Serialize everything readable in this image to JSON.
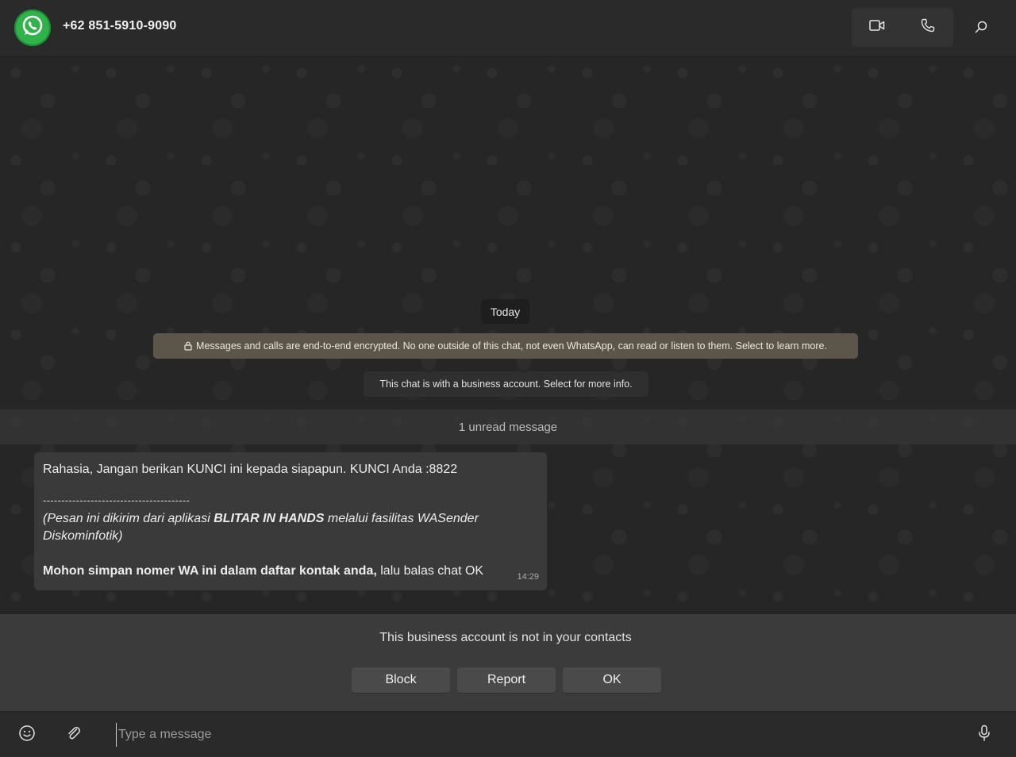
{
  "header": {
    "contact_name": "+62 851-5910-9090",
    "avatar_icon": "whatsapp-logo-icon",
    "video_call_icon": "video-camera-icon",
    "voice_call_icon": "phone-icon",
    "search_icon": "search-icon"
  },
  "chat": {
    "date_pill": "Today",
    "encryption_notice": "Messages and calls are end-to-end encrypted. No one outside of this chat, not even WhatsApp, can read or listen to them. Select to learn more.",
    "business_notice": "This chat is with a business account. Select for more info.",
    "unread_label": "1 unread message",
    "message": {
      "line1": "Rahasia, Jangan berikan KUNCI ini kepada siapapun. KUNCI Anda :8822",
      "separator": "----------------------------------------",
      "italic_prefix": "(Pesan ini dikirim dari aplikasi ",
      "italic_app": "BLITAR IN HANDS",
      "italic_suffix": " melalui fasilitas WASender Diskominfotik)",
      "closing_bold": "Mohon simpan nomer WA ini dalam daftar kontak anda,",
      "closing_rest": " lalu balas chat OK",
      "time": "14:29"
    }
  },
  "notice": {
    "text": "This business account is not in your contacts",
    "buttons": {
      "block": "Block",
      "report": "Report",
      "ok": "OK"
    }
  },
  "composer": {
    "placeholder": "Type a message",
    "emoji_icon": "emoji-icon",
    "attach_icon": "paperclip-icon",
    "mic_icon": "microphone-icon"
  },
  "colors": {
    "brand_green": "#2fb34a",
    "encryption_banner": "#5c5549",
    "bubble": "#3a3a3a"
  }
}
